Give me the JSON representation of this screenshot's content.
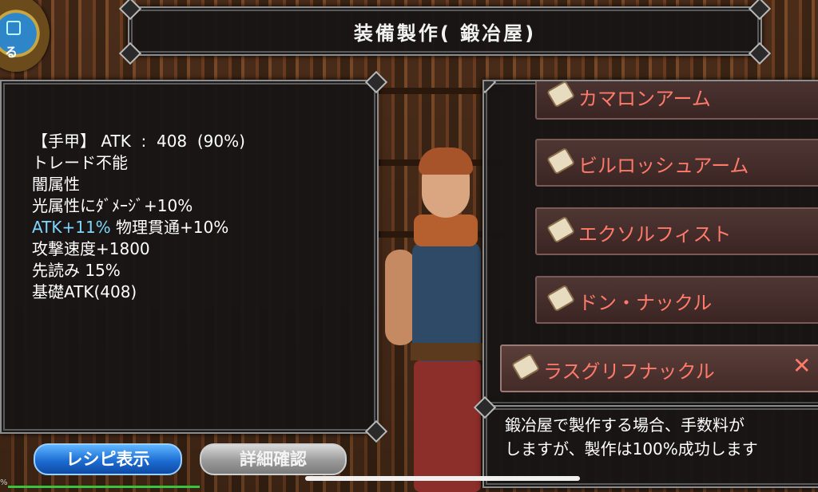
{
  "header": {
    "title": "装備製作( 鍛冶屋)"
  },
  "back_button": {
    "label": "る"
  },
  "item_stats": {
    "line1": "【手甲】 ATK  :  408  (90%)",
    "line2": "トレード不能",
    "line3": "闇属性",
    "line4": "光属性にﾀﾞﾒｰｼﾞ+10%",
    "line5_accent": "ATK+11%",
    "line5_rest": " 物理貫通+10%",
    "line6": "攻撃速度+1800",
    "line7": "先読み 15%",
    "line8": "基礎ATK(408)"
  },
  "recipes": [
    {
      "name": "カマロンアーム"
    },
    {
      "name": "ビルロッシュアーム"
    },
    {
      "name": "エクソルフィスト"
    },
    {
      "name": "ドン・ナックル"
    },
    {
      "name": "ラスグリフナックル",
      "selected": true,
      "close_icon": "✕"
    }
  ],
  "message": {
    "line1": "鍛冶屋で製作する場合、手数料が",
    "line2": "しますが、製作は100%成功します"
  },
  "buttons": {
    "recipe_display": "レシピ表示",
    "details": "詳細確認"
  },
  "progress": {
    "percent_label": "%",
    "fill_fraction": 0.23
  },
  "colors": {
    "accent_blue": "#7fd6ff",
    "recipe_text": "#ff7a6a",
    "button_blue": "#1d6dd3"
  }
}
